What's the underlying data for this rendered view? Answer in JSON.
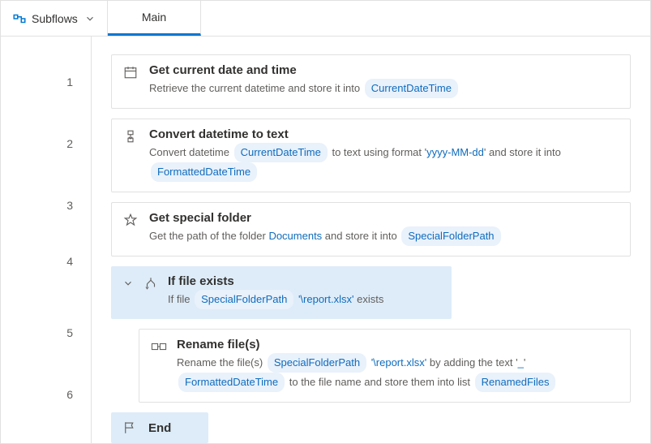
{
  "topbar": {
    "subflows_label": "Subflows",
    "tab_main": "Main"
  },
  "lines": [
    "1",
    "2",
    "3",
    "4",
    "5",
    "6"
  ],
  "actions": {
    "a1": {
      "title": "Get current date and time",
      "desc_prefix": "Retrieve the current datetime and store it into ",
      "var1": "CurrentDateTime"
    },
    "a2": {
      "title": "Convert datetime to text",
      "d1": "Convert datetime ",
      "var1": "CurrentDateTime",
      "d2": " to text using format '",
      "fmt": "yyyy-MM-dd",
      "d3": "' and store it into ",
      "var2": "FormattedDateTime"
    },
    "a3": {
      "title": "Get special folder",
      "d1": "Get the path of the folder ",
      "folder": "Documents",
      "d2": " and store it into ",
      "var1": "SpecialFolderPath"
    },
    "cond": {
      "title": "If file exists",
      "d1": "If file ",
      "var1": "SpecialFolderPath",
      "path": " '\\report.xlsx'",
      "d2": " exists"
    },
    "a5": {
      "title": "Rename file(s)",
      "d1": "Rename the file(s) ",
      "var1": "SpecialFolderPath",
      "path": " '\\report.xlsx'",
      "d2": " by adding the text '",
      "underscore": "_",
      "d3": "' ",
      "var2": "FormattedDateTime",
      "d4": " to the file name and store them into list ",
      "var3": "RenamedFiles"
    },
    "end": {
      "title": "End"
    }
  }
}
